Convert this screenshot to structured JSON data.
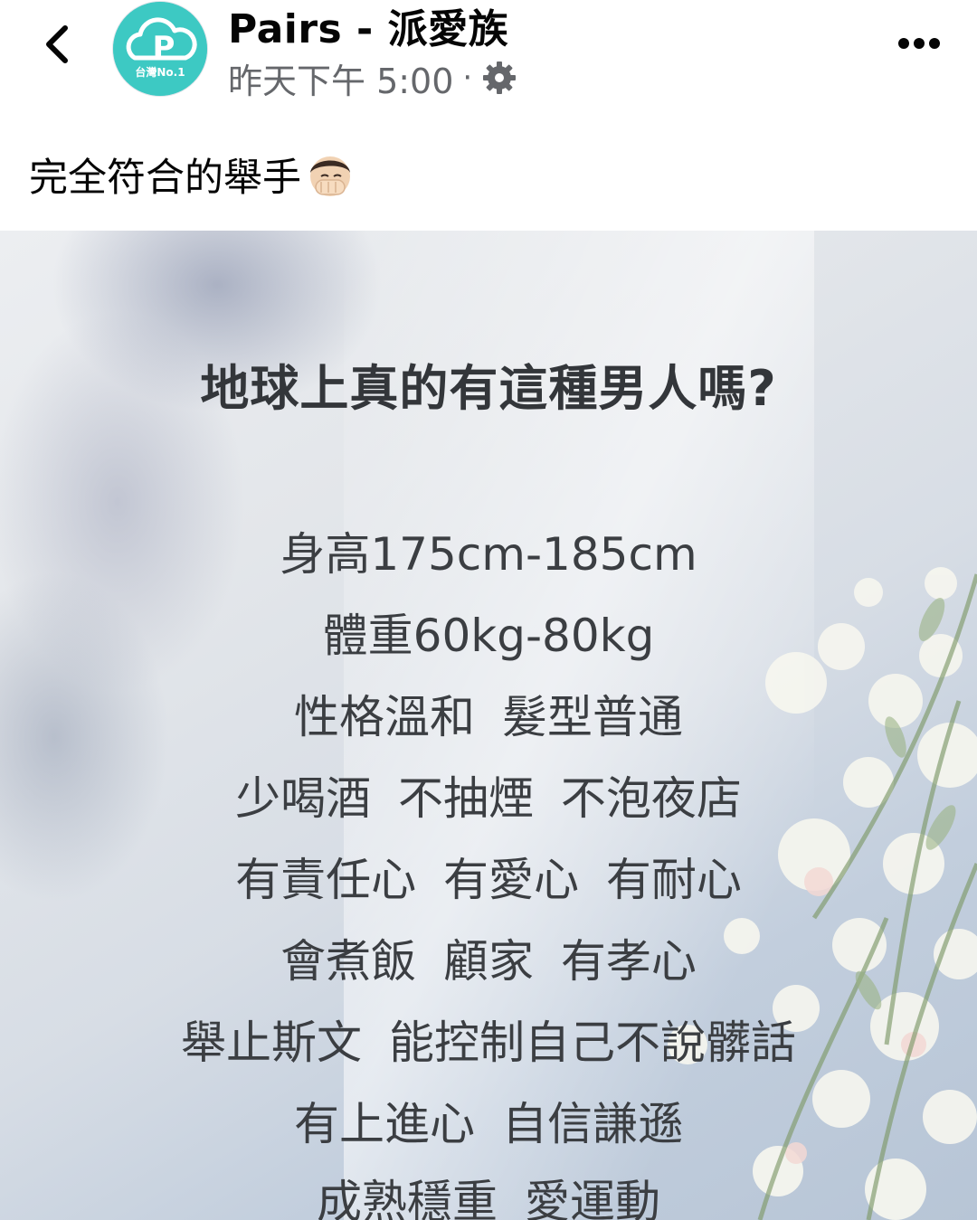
{
  "header": {
    "back_icon": "chevron-left-icon",
    "avatar": {
      "letter": "P",
      "badge": "台灣No.1",
      "color": "#3dc9c3"
    },
    "page_name": "Pairs - 派愛族",
    "timestamp": "昨天下午 5:00",
    "separator": "·",
    "audience_icon": "gear-icon",
    "more_icon": "more-horizontal-icon"
  },
  "post": {
    "caption": "完全符合的舉手",
    "caption_emoji": "face-palm-emoji"
  },
  "image": {
    "title": "地球上真的有這種男人嗎?",
    "lines": [
      "身高175cm-185cm",
      "體重60kg-80kg",
      "性格溫和  髮型普通",
      "少喝酒  不抽煙  不泡夜店",
      "有責任心  有愛心  有耐心",
      "會煮飯  顧家  有孝心",
      "舉止斯文  能控制自己不說髒話",
      "有上進心  自信謙遜",
      "成熟穩重  愛運動"
    ]
  }
}
